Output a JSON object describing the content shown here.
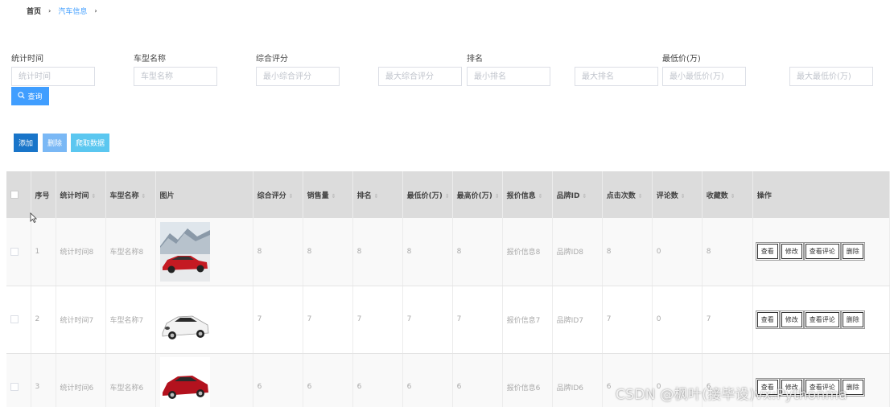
{
  "breadcrumb": {
    "home": "首页",
    "separator": "›",
    "current": "汽车信息"
  },
  "filters": [
    {
      "label": "统计时间",
      "placeholder": "统计时间"
    },
    {
      "label": "车型名称",
      "placeholder": "车型名称"
    },
    {
      "label": "综合评分",
      "placeholder": "最小综合评分"
    },
    {
      "label": "",
      "placeholder": "最大综合评分"
    },
    {
      "label": "排名",
      "placeholder": "最小排名"
    },
    {
      "label": "",
      "placeholder": "最大排名"
    },
    {
      "label": "最低价(万)",
      "placeholder": "最小最低价(万)"
    },
    {
      "label": "",
      "placeholder": "最大最低价(万)"
    }
  ],
  "search_button": "查询",
  "actions": {
    "add": "添加",
    "delete": "删除",
    "crawl": "爬取数据"
  },
  "columns": [
    "序号",
    "统计时间",
    "车型名称",
    "图片",
    "综合评分",
    "销售量",
    "排名",
    "最低价(万)",
    "最高价(万)",
    "报价信息",
    "品牌ID",
    "点击次数",
    "评论数",
    "收藏数",
    "操作"
  ],
  "rows": [
    {
      "index": "1",
      "stat_time": "统计时间8",
      "model": "车型名称8",
      "score": "8",
      "sales": "8",
      "rank": "8",
      "min_price": "8",
      "max_price": "8",
      "quote": "报价信息8",
      "brand_id": "品牌ID8",
      "clicks": "8",
      "comments": "0",
      "favorites": "8",
      "car_color": "#c41a22"
    },
    {
      "index": "2",
      "stat_time": "统计时间7",
      "model": "车型名称7",
      "score": "7",
      "sales": "7",
      "rank": "7",
      "min_price": "7",
      "max_price": "7",
      "quote": "报价信息7",
      "brand_id": "品牌ID7",
      "clicks": "7",
      "comments": "0",
      "favorites": "7",
      "car_color": "#f2f2f2"
    },
    {
      "index": "3",
      "stat_time": "统计时间6",
      "model": "车型名称6",
      "score": "6",
      "sales": "6",
      "rank": "6",
      "min_price": "6",
      "max_price": "6",
      "quote": "报价信息6",
      "brand_id": "品牌ID6",
      "clicks": "6",
      "comments": "0",
      "favorites": "6",
      "car_color": "#b3121e"
    }
  ],
  "row_actions": {
    "view": "查看",
    "edit": "修改",
    "view_comments": "查看评论",
    "delete": "删除"
  },
  "watermark": "CSDN @枫叶(接毕设)vx:Pythonma",
  "colors": {
    "primary": "#409eff",
    "add": "#1975c9",
    "delete": "#7ab8f5",
    "crawl": "#5bc7f0",
    "header_bg": "#dcdcdc"
  }
}
